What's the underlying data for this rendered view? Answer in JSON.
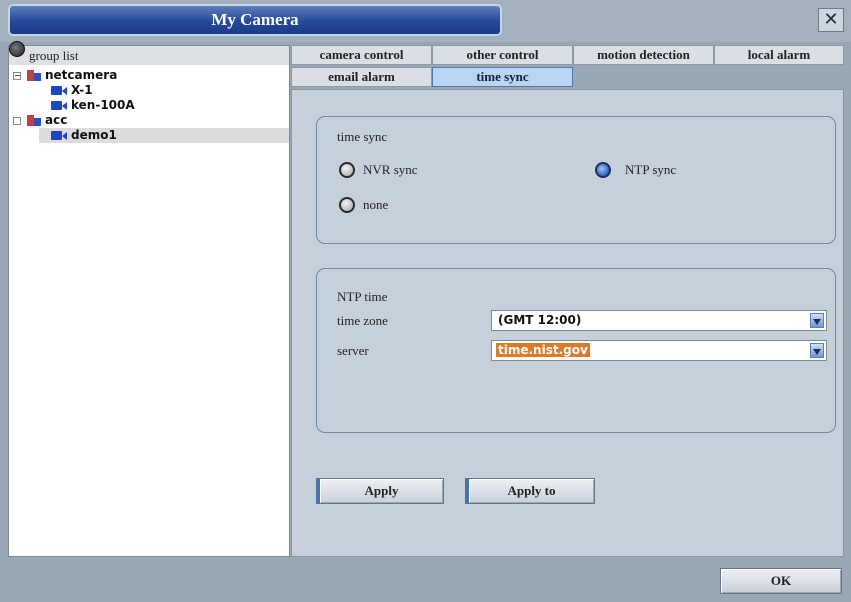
{
  "window": {
    "title": "My Camera",
    "close_glyph": "✕"
  },
  "group_list": {
    "header": "group list",
    "tree": [
      {
        "label": "netcamera",
        "type": "group",
        "expander": "−"
      },
      {
        "label": "X-1",
        "type": "camera"
      },
      {
        "label": "ken-100A",
        "type": "camera"
      },
      {
        "label": "acc",
        "type": "group",
        "expander": ""
      },
      {
        "label": "demo1",
        "type": "camera",
        "selected": true
      }
    ]
  },
  "tabs": {
    "row1": [
      "camera control",
      "other control",
      "motion detection",
      "local alarm"
    ],
    "row2": [
      "email alarm",
      "time sync"
    ],
    "active": "time sync"
  },
  "time_sync": {
    "title": "time sync",
    "options": [
      {
        "label": "NVR sync",
        "checked": false
      },
      {
        "label": "NTP sync",
        "checked": true
      },
      {
        "label": "none",
        "checked": false
      }
    ]
  },
  "ntp_time": {
    "title": "NTP time",
    "time_zone_label": "time zone",
    "time_zone_value": "(GMT 12:00)",
    "server_label": "server",
    "server_value": "time.nist.gov"
  },
  "buttons": {
    "apply": "Apply",
    "apply_to": "Apply to",
    "ok": "OK"
  },
  "colors": {
    "title_bar": "#26489a",
    "active_tab": "#b9d5f2",
    "selection": "#e07a26"
  }
}
